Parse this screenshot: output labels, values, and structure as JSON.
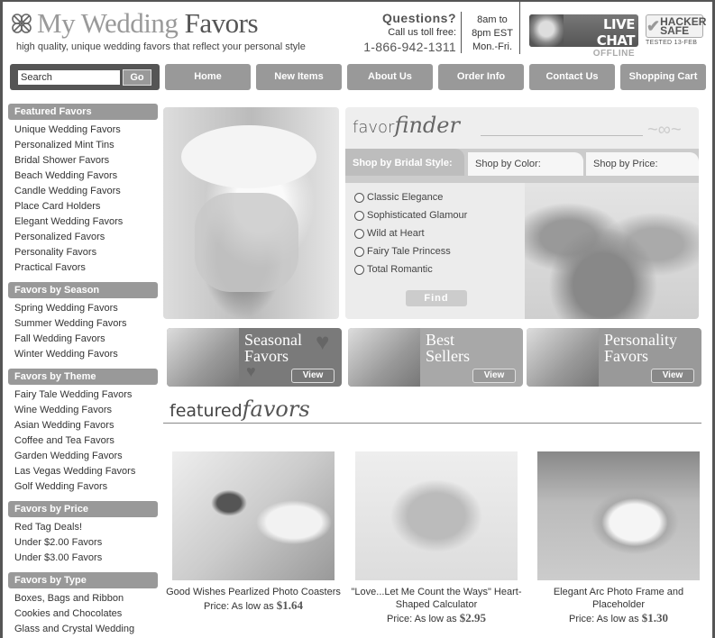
{
  "header": {
    "logo_light": "My Wedding",
    "logo_dark": "Favors",
    "tagline": "high quality, unique wedding favors that reflect your personal style",
    "questions_title": "Questions?",
    "questions_sub": "Call us toll free:",
    "phone": "1-866-942-1311",
    "hours": [
      "8am to",
      "8pm EST",
      "Mon.-Fri."
    ],
    "live_chat": {
      "main": "LIVE CHAT",
      "status": "OFFLINE"
    },
    "hacker_safe": {
      "line1": "HACKER",
      "line2": "SAFE",
      "tested": "TESTED  13-FEB"
    }
  },
  "nav": {
    "search_placeholder": "Search",
    "go_label": "Go",
    "items": [
      "Home",
      "New Items",
      "About Us",
      "Order Info",
      "Contact Us",
      "Shopping Cart"
    ]
  },
  "sidebar": {
    "sections": [
      {
        "title": "Featured Favors",
        "items": [
          "Unique Wedding Favors",
          "Personalized Mint Tins",
          "Bridal Shower Favors",
          "Beach Wedding Favors",
          "Candle Wedding Favors",
          "Place Card Holders",
          "Elegant Wedding Favors",
          "Personalized Favors",
          "Personality Favors",
          "Practical Favors"
        ]
      },
      {
        "title": "Favors by Season",
        "items": [
          "Spring Wedding Favors",
          "Summer Wedding Favors",
          "Fall Wedding Favors",
          "Winter Wedding Favors"
        ]
      },
      {
        "title": "Favors by Theme",
        "items": [
          "Fairy Tale Wedding Favors",
          "Wine Wedding Favors",
          "Asian Wedding Favors",
          "Coffee and Tea Favors",
          "Garden Wedding Favors",
          "Las Vegas Wedding Favors",
          "Golf Wedding Favors"
        ]
      },
      {
        "title": "Favors by Price",
        "items": [
          "Red Tag Deals!",
          "Under $2.00 Favors",
          "Under $3.00 Favors"
        ]
      },
      {
        "title": "Favors by Type",
        "items": [
          "Boxes, Bags and Ribbon",
          "Cookies and Chocolates",
          "Glass and Crystal Wedding"
        ]
      }
    ]
  },
  "finder": {
    "title_plain": "favor",
    "title_script": "finder",
    "tabs": [
      "Shop by Bridal Style:",
      "Shop by Color:",
      "Shop by Price:"
    ],
    "options": [
      "Classic Elegance",
      "Sophisticated Glamour",
      "Wild at Heart",
      "Fairy Tale Princess",
      "Total Romantic"
    ],
    "find_label": "Find"
  },
  "promos": [
    {
      "line1": "Seasonal",
      "line2": "Favors",
      "view": "View"
    },
    {
      "line1": "Best",
      "line2": "Sellers",
      "view": "View"
    },
    {
      "line1": "Personality",
      "line2": "Favors",
      "view": "View"
    }
  ],
  "featured": {
    "title_plain": "featured",
    "title_script": "favors",
    "products": [
      {
        "name": "Good Wishes Pearlized Photo Coasters",
        "price_label": "Price: As low as",
        "price": "$1.64"
      },
      {
        "name": "\"Love...Let Me Count the Ways\" Heart-Shaped Calculator",
        "price_label": "Price: As low as",
        "price": "$2.95"
      },
      {
        "name": "Elegant Arc Photo Frame and Placeholder",
        "price_label": "Price: As low as",
        "price": "$1.30"
      }
    ]
  }
}
